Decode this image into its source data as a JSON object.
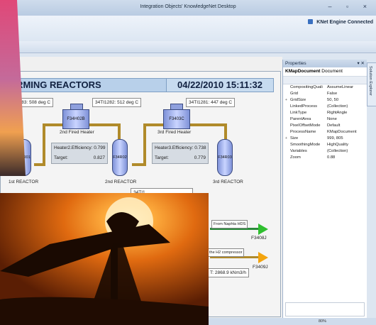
{
  "window": {
    "title": "Integration Objects' KnowledgeNet Desktop",
    "controls": [
      "–",
      "▫",
      "×"
    ]
  },
  "status": {
    "engine": "KNet Engine Connected"
  },
  "process": {
    "title_left": "FORMING REACTORS",
    "title_right": "04/22/2010 15:11:32",
    "tags": {
      "t1": "34TI1283: 508 deg C",
      "t2": "34TI1282: 512 deg C",
      "t3": "34TI1281: 447 deg C",
      "t4": "34TI1...",
      "flow": "T: 2868.9 kNm3/h"
    },
    "heaters": {
      "h2_id": "F34H02B",
      "h2_label": "2nd Fired Heater",
      "h3_id": "F3403C",
      "h3_label": "3rd Fired Heater"
    },
    "reactors": {
      "r1_id": "F34R01",
      "r1_label": "1st REACTOR",
      "r2_id": "F34R02",
      "r2_label": "2nd REACTOR",
      "r3_id": "F34R03",
      "r3_label": "3rd REACTOR"
    },
    "efficiency": {
      "h2_label": "Heater2.Efficiency: 0.799",
      "h2_target_label": "Target:",
      "h2_target": "0.827",
      "h3_label": "Heater3.Efficiency: 0.738",
      "h3_target_label": "Target:",
      "h3_target": "0.779"
    },
    "streams": {
      "s1_label": "From Naphta HDS",
      "s1_id": "F3408J",
      "s2_label": "the H2 compressor",
      "s2_id": "F3409J"
    }
  },
  "properties": {
    "panel_title": "Properties",
    "pin": "▾ ✕",
    "object_name": "KMapDocument",
    "object_type": "Document",
    "rows": [
      {
        "name": "CompositingQuali",
        "value": "AssumeLinear",
        "exp": ""
      },
      {
        "name": "Grid",
        "value": "False",
        "exp": ""
      },
      {
        "name": "GridSize",
        "value": "50, 50",
        "exp": "+"
      },
      {
        "name": "LinkedProcess",
        "value": "(Collection)",
        "exp": ""
      },
      {
        "name": "LinkType",
        "value": "RightAngle",
        "exp": ""
      },
      {
        "name": "ParentArea",
        "value": "None",
        "exp": ""
      },
      {
        "name": "PixelOffsetMode",
        "value": "Default",
        "exp": ""
      },
      {
        "name": "ProcessName",
        "value": "KMapDocument",
        "exp": ""
      },
      {
        "name": "Size",
        "value": "999, 805",
        "exp": "+"
      },
      {
        "name": "SmoothingMode",
        "value": "HighQuality",
        "exp": ""
      },
      {
        "name": "Variables",
        "value": "(Collection)",
        "exp": ""
      },
      {
        "name": "Zoom",
        "value": "0.88",
        "exp": ""
      }
    ]
  },
  "side_tab": "Solution Explorer",
  "statusbar": {
    "zoom": "80%"
  },
  "colors": {
    "header_bg": "#b8d0ea",
    "pipe": "#b08a2a",
    "pipe_green": "#2a8a3a",
    "arrow_green": "#2fbf2f",
    "arrow_orange": "#f3a40f"
  }
}
